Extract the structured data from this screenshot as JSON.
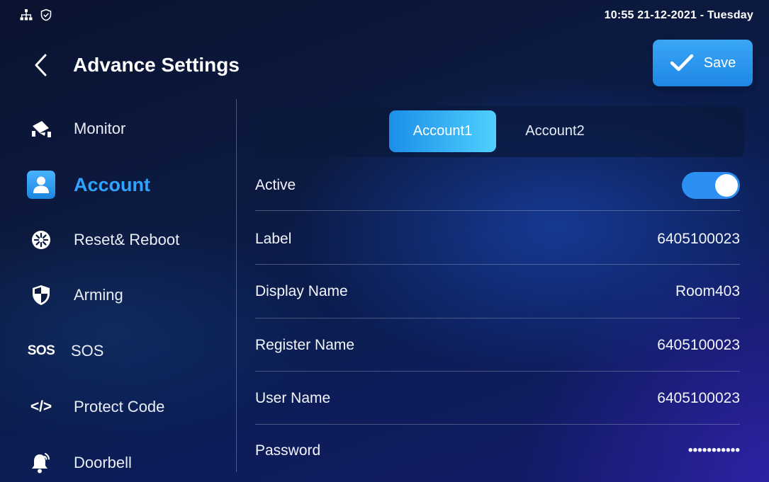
{
  "status_bar": {
    "datetime": "10:55  21-12-2021 - Tuesday",
    "icons": [
      "network-icon",
      "shield-check-icon"
    ]
  },
  "header": {
    "title": "Advance Settings",
    "save_label": "Save"
  },
  "sidebar": {
    "items": [
      {
        "label": "Monitor",
        "icon": "monitor-camera-icon",
        "active": false
      },
      {
        "label": "Account",
        "icon": "account-icon",
        "active": true
      },
      {
        "label": "Reset& Reboot",
        "icon": "reset-reboot-icon",
        "active": false
      },
      {
        "label": "Arming",
        "icon": "arming-shield-icon",
        "active": false
      },
      {
        "label": "SOS",
        "icon_text": "SOS",
        "icon": "sos-icon",
        "active": false
      },
      {
        "label": "Protect Code",
        "icon_text": "</>",
        "icon": "code-icon",
        "active": false
      },
      {
        "label": "Doorbell",
        "icon": "doorbell-icon",
        "active": false
      }
    ]
  },
  "tabs": {
    "items": [
      {
        "label": "Account1",
        "selected": true
      },
      {
        "label": "Account2",
        "selected": false
      }
    ]
  },
  "account": {
    "active_label": "Active",
    "active_on": true,
    "fields": [
      {
        "label": "Label",
        "value": "6405100023"
      },
      {
        "label": "Display Name",
        "value": "Room403"
      },
      {
        "label": "Register Name",
        "value": "6405100023"
      },
      {
        "label": "User Name",
        "value": "6405100023"
      },
      {
        "label": "Password",
        "value": "•••••••••••"
      }
    ]
  },
  "colors": {
    "accent": "#2ea3ff",
    "toggle_on": "#2c8ff2",
    "background": "#0c1a40"
  }
}
